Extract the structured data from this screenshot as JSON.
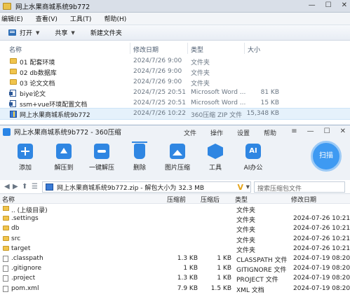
{
  "explorer": {
    "title": "网上水果商城系统9b772",
    "window_buttons": [
      "—",
      "☐",
      "✕"
    ],
    "menu": [
      "编辑(E)",
      "查看(V)",
      "工具(T)",
      "帮助(H)"
    ],
    "commands": {
      "open": "打开",
      "share": "共享",
      "new_folder": "新建文件夹"
    },
    "columns": {
      "name": "名称",
      "modified": "修改日期",
      "type": "类型",
      "size": "大小"
    },
    "rows": [
      {
        "name": "01 配套环境",
        "modified": "2024/7/26 9:00",
        "type": "文件夹",
        "size": "",
        "icon": "folder-icon"
      },
      {
        "name": "02 db数据库",
        "modified": "2024/7/26 9:00",
        "type": "文件夹",
        "size": "",
        "icon": "folder-icon"
      },
      {
        "name": "03 论文文档",
        "modified": "2024/7/26 9:00",
        "type": "文件夹",
        "size": "",
        "icon": "folder-icon"
      },
      {
        "name": "biye论文",
        "modified": "2024/7/25 20:51",
        "type": "Microsoft Word ...",
        "size": "81 KB",
        "icon": "word-doc-icon"
      },
      {
        "name": "ssm+vue环境配置文档",
        "modified": "2024/7/25 20:51",
        "type": "Microsoft Word ...",
        "size": "15 KB",
        "icon": "word-doc-icon"
      },
      {
        "name": "网上水果商城系统9b772",
        "modified": "2024/7/26 10:22",
        "type": "360压缩 ZIP 文件",
        "size": "15,348 KB",
        "icon": "zip-icon"
      }
    ]
  },
  "zip": {
    "title": "网上水果商城系统9b772 - 360压缩",
    "menu": [
      "文件",
      "操作",
      "设置",
      "帮助"
    ],
    "window_buttons": [
      "≡",
      "—",
      "☐",
      "✕"
    ],
    "tools": [
      "添加",
      "解压到",
      "一键解压",
      "删除",
      "图片压缩",
      "工具",
      "AI办公"
    ],
    "scan_label": "扫描",
    "nav": {
      "back": "◀",
      "forward": "▶",
      "up": "⬆",
      "view": "☰"
    },
    "path": "网上水果商城系统9b772.zip - 解包大小为 32.3 MB",
    "search_placeholder": "搜索压缩包文件",
    "columns": {
      "name": "名称",
      "compressed": "压缩前",
      "original": "压缩后",
      "type": "类型",
      "modified": "修改日期"
    },
    "rows": [
      {
        "name": ".. (上级目录)",
        "compressed": "",
        "original": "",
        "type": "文件夹",
        "modified": "",
        "icon": "folder-up-icon"
      },
      {
        "name": ".settings",
        "compressed": "",
        "original": "",
        "type": "文件夹",
        "modified": "2024-07-26 10:21",
        "icon": "folder-icon"
      },
      {
        "name": "db",
        "compressed": "",
        "original": "",
        "type": "文件夹",
        "modified": "2024-07-26 10:21",
        "icon": "folder-icon"
      },
      {
        "name": "src",
        "compressed": "",
        "original": "",
        "type": "文件夹",
        "modified": "2024-07-26 10:21",
        "icon": "folder-icon"
      },
      {
        "name": "target",
        "compressed": "",
        "original": "",
        "type": "文件夹",
        "modified": "2024-07-26 10:21",
        "icon": "folder-icon"
      },
      {
        "name": ".classpath",
        "compressed": "1.3 KB",
        "original": "1 KB",
        "type": "CLASSPATH 文件",
        "modified": "2024-07-19 08:20",
        "icon": "file-icon"
      },
      {
        "name": ".gitignore",
        "compressed": "1 KB",
        "original": "1 KB",
        "type": "GITIGNORE 文件",
        "modified": "2024-07-19 08:20",
        "icon": "file-icon"
      },
      {
        "name": ".project",
        "compressed": "1.3 KB",
        "original": "1 KB",
        "type": "PROJECT 文件",
        "modified": "2024-07-19 08:20",
        "icon": "file-icon"
      },
      {
        "name": "pom.xml",
        "compressed": "7.9 KB",
        "original": "1.5 KB",
        "type": "XML 文档",
        "modified": "2024-07-19 08:20",
        "icon": "file-icon"
      }
    ]
  }
}
